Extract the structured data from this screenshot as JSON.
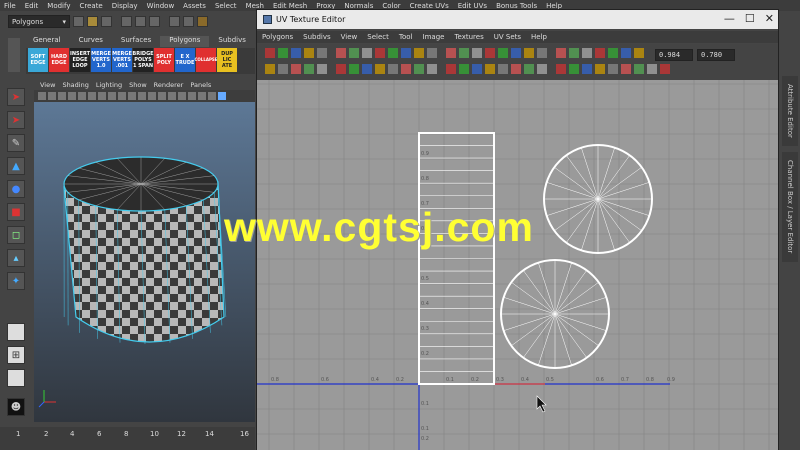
{
  "main_menu": [
    "File",
    "Edit",
    "Modify",
    "Create",
    "Display",
    "Window",
    "Assets",
    "Select",
    "Mesh",
    "Edit Mesh",
    "Proxy",
    "Normals",
    "Color",
    "Create UVs",
    "Edit UVs",
    "Bonus Tools",
    "Help"
  ],
  "status_line": {
    "mode": "Polygons"
  },
  "shelf_tabs": [
    "General",
    "Curves",
    "Surfaces",
    "Polygons",
    "Subdivs"
  ],
  "shelf_active": "Polygons",
  "shelf_buttons": [
    {
      "label": "SOFT\nEDGE",
      "color": "#3aa8d8"
    },
    {
      "label": "HARD\nEDGE",
      "color": "#e03030"
    },
    {
      "label": "INSERT\nEDGE\nLOOP",
      "color": "#222222"
    },
    {
      "label": "MERGE\nVERTS\n1.0",
      "color": "#2266cc"
    },
    {
      "label": "MERGE\nVERTS\n.001",
      "color": "#2266cc"
    },
    {
      "label": "BRIDGE\nPOLYS\n1 SPAN",
      "color": "#222222"
    },
    {
      "label": "SPLIT\nPOLY",
      "color": "#e03030"
    },
    {
      "label": "E X\nTRUDE",
      "color": "#2266cc"
    },
    {
      "label": "COLLAPSE",
      "color": "#e03030"
    },
    {
      "label": "DUP\nLIC\nATE",
      "color": "#e8c020"
    }
  ],
  "viewport_menu": [
    "View",
    "Shading",
    "Lighting",
    "Show",
    "Renderer",
    "Panels"
  ],
  "time_slider": {
    "start": "1",
    "ticks": [
      "2",
      "4",
      "6",
      "8",
      "10",
      "12",
      "14",
      "16"
    ]
  },
  "uv_editor": {
    "title": "UV Texture Editor",
    "menu": [
      "Polygons",
      "Subdivs",
      "View",
      "Select",
      "Tool",
      "Image",
      "Textures",
      "UV Sets",
      "Help"
    ],
    "u_field": "0.984",
    "v_field": "0.780",
    "grid_labels_v": [
      "0.9",
      "0.8",
      "0.7",
      "0.6",
      "0.5",
      "0.4",
      "0.3",
      "0.2",
      "0.1",
      "0.1",
      "0.2"
    ],
    "grid_labels_u": [
      "0.8",
      "0.6",
      "0.4",
      "0.2",
      "0.1",
      "0.2",
      "0.3",
      "0.4",
      "0.5",
      "0.6",
      "0.7",
      "0.8",
      "0.9"
    ]
  },
  "side_tabs": [
    "Attribute Editor",
    "Channel Box / Layer Editor"
  ],
  "watermark": "www.cgtsj.com",
  "colors": {
    "uv_background": "#9a9a9a",
    "viewport_top": "#5d7896",
    "watermark": "#ffff33",
    "uv_shell": "#ffffff",
    "u_axis": "#2233cc",
    "selection_edge": "#44ccee"
  }
}
